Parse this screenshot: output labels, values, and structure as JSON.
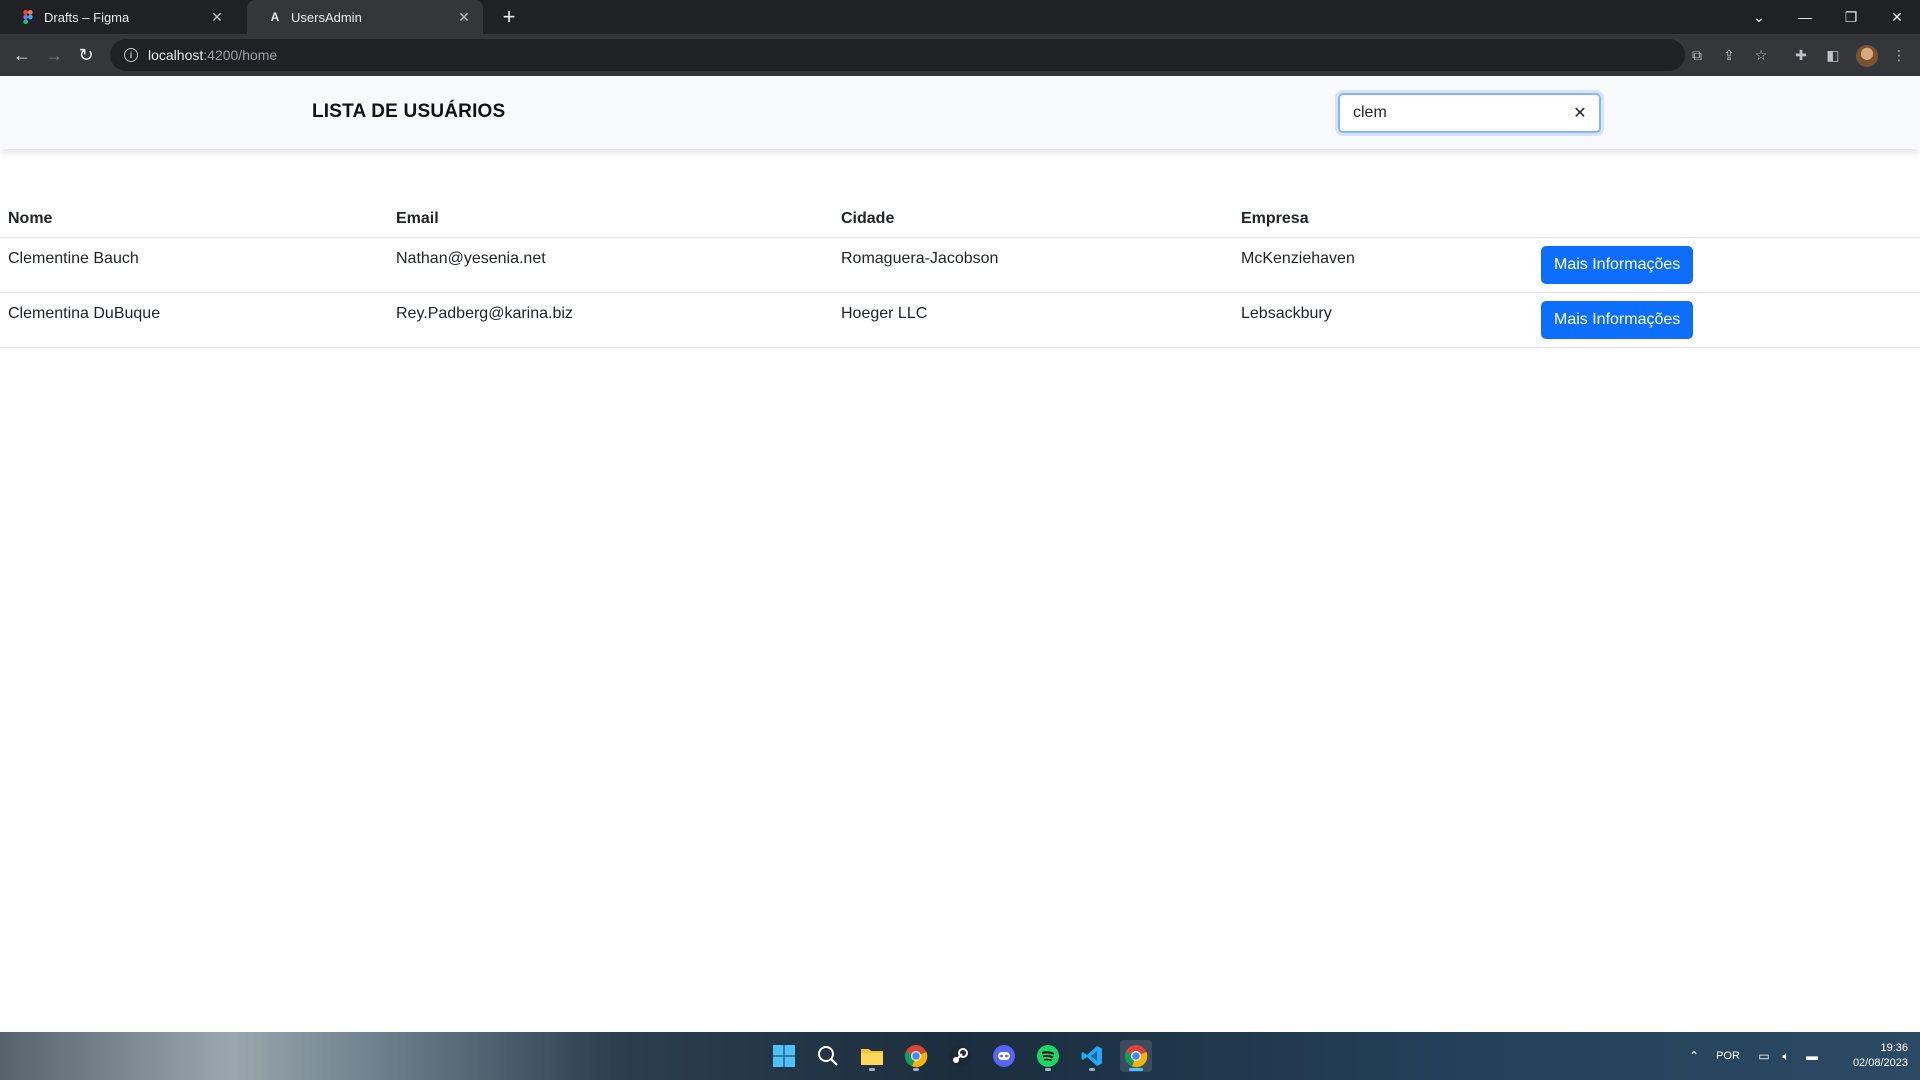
{
  "browser": {
    "tabs": [
      {
        "title": "Drafts – Figma",
        "icon": "figma-icon",
        "active": false
      },
      {
        "title": "UsersAdmin",
        "icon": "angular-icon",
        "active": true
      }
    ],
    "url_host": "localhost",
    "url_path": ":4200/home"
  },
  "header": {
    "title": "LISTA DE USUÁRIOS",
    "search_value": "clem"
  },
  "table": {
    "columns": [
      "Nome",
      "Email",
      "Cidade",
      "Empresa"
    ],
    "rows": [
      {
        "nome": "Clementine Bauch",
        "email": "Nathan@yesenia.net",
        "cidade": "Romaguera-Jacobson",
        "empresa": "McKenziehaven",
        "action": "Mais Informações"
      },
      {
        "nome": "Clementina DuBuque",
        "email": "Rey.Padberg@karina.biz",
        "cidade": "Hoeger LLC",
        "empresa": "Lebsackbury",
        "action": "Mais Informações"
      }
    ]
  },
  "taskbar": {
    "apps": [
      "windows-start-icon",
      "search-icon",
      "file-explorer-icon",
      "chrome-icon",
      "steam-icon",
      "discord-icon",
      "spotify-icon",
      "vscode-icon",
      "chrome-icon"
    ],
    "language": "POR",
    "time": "19:36",
    "date": "02/08/2023"
  },
  "colors": {
    "primary_button": "#0d6efd",
    "header_bg": "#f8f9fa",
    "search_focus_border": "#86b7fe"
  }
}
